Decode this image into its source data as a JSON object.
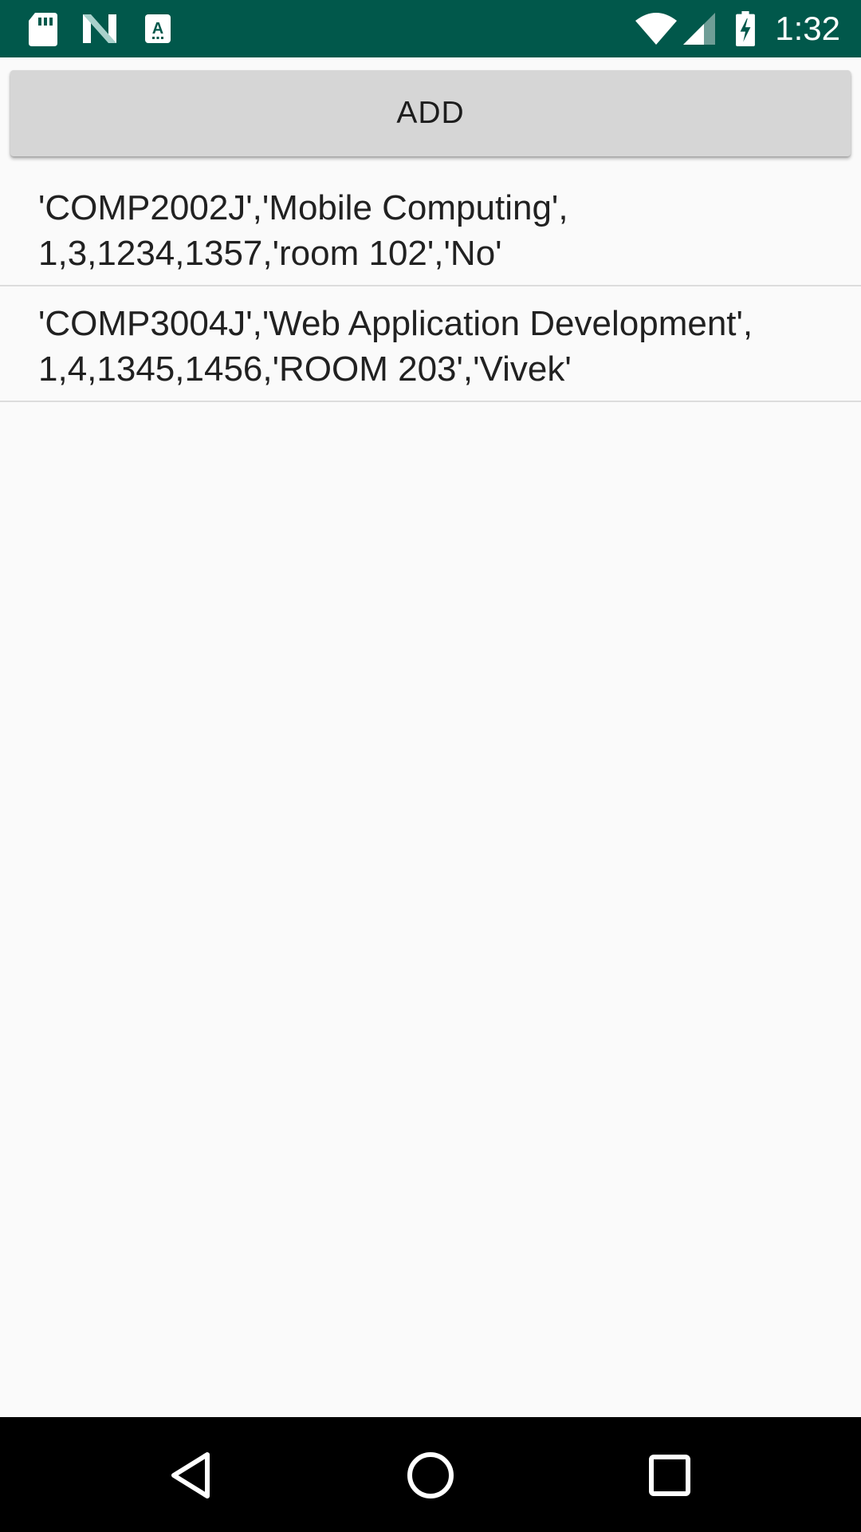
{
  "status_bar": {
    "time": "1:32",
    "background_color": "#01584b",
    "icons": [
      "sd-card-icon",
      "n-logo-icon",
      "a-text-icon",
      "wifi-icon",
      "signal-icon",
      "battery-charging-icon"
    ]
  },
  "toolbar": {
    "add_label": "ADD"
  },
  "courses": [
    {
      "line": "'COMP2002J','Mobile Computing',\n1,3,1234,1357,'room 102','No'"
    },
    {
      "line": "'COMP3004J','Web Application Development',\n1,4,1345,1456,'ROOM 203','Vivek'"
    }
  ],
  "nav_bar": {
    "icons": [
      "back-icon",
      "home-icon",
      "recents-icon"
    ]
  }
}
